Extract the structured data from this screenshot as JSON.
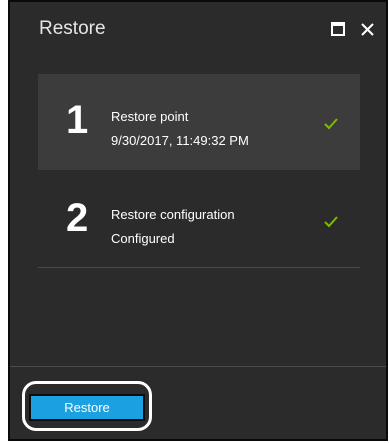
{
  "blade": {
    "title": "Restore",
    "maximize_icon": "maximize-icon",
    "close_icon": "close-icon"
  },
  "steps": [
    {
      "number": "1",
      "title": "Restore point",
      "subtitle": "9/30/2017, 11:49:32 PM",
      "status_icon": "checkmark-icon",
      "selected": true
    },
    {
      "number": "2",
      "title": "Restore configuration",
      "subtitle": "Configured",
      "status_icon": "checkmark-icon",
      "selected": false
    }
  ],
  "footer": {
    "restore_label": "Restore"
  },
  "colors": {
    "blade_background": "#2b2b2b",
    "selected_step_background": "#3c3c3c",
    "check_green": "#7fba00",
    "button_blue": "#1ba1e2",
    "text": "#ffffff"
  }
}
